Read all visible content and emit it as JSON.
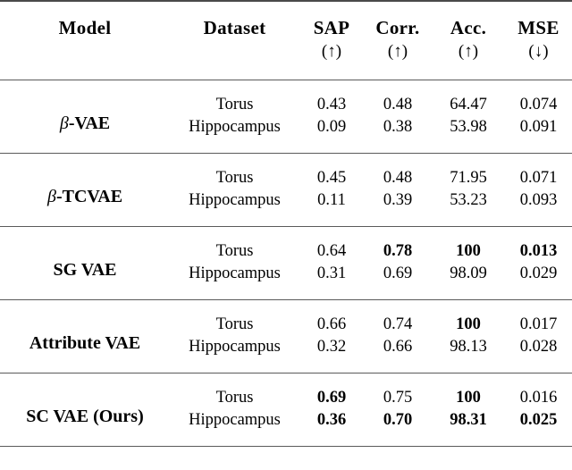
{
  "table": {
    "columns": [
      {
        "key": "model",
        "label": "Model",
        "arrow": ""
      },
      {
        "key": "dataset",
        "label": "Dataset",
        "arrow": ""
      },
      {
        "key": "sap",
        "label": "SAP",
        "arrow": "(↑)"
      },
      {
        "key": "corr",
        "label": "Corr.",
        "arrow": "(↑)"
      },
      {
        "key": "acc",
        "label": "Acc.",
        "arrow": "(↑)"
      },
      {
        "key": "mse",
        "label": "MSE",
        "arrow": "(↓)"
      }
    ],
    "groups": [
      {
        "model_prefix": "β",
        "model_rest": "-VAE",
        "rows": [
          {
            "dataset": "Torus",
            "dataset_bold": false,
            "sap": "0.43",
            "sap_bold": false,
            "corr": "0.48",
            "corr_bold": false,
            "acc": "64.47",
            "acc_bold": false,
            "mse": "0.074",
            "mse_bold": false
          },
          {
            "dataset": "Hippocampus",
            "dataset_bold": false,
            "sap": "0.09",
            "sap_bold": false,
            "corr": "0.38",
            "corr_bold": false,
            "acc": "53.98",
            "acc_bold": false,
            "mse": "0.091",
            "mse_bold": false
          }
        ]
      },
      {
        "model_prefix": "β",
        "model_rest": "-TCVAE",
        "rows": [
          {
            "dataset": "Torus",
            "dataset_bold": false,
            "sap": "0.45",
            "sap_bold": false,
            "corr": "0.48",
            "corr_bold": false,
            "acc": "71.95",
            "acc_bold": false,
            "mse": "0.071",
            "mse_bold": false
          },
          {
            "dataset": "Hippocampus",
            "dataset_bold": false,
            "sap": "0.11",
            "sap_bold": false,
            "corr": "0.39",
            "corr_bold": false,
            "acc": "53.23",
            "acc_bold": false,
            "mse": "0.093",
            "mse_bold": false
          }
        ]
      },
      {
        "model_prefix": "",
        "model_rest": "SG VAE",
        "rows": [
          {
            "dataset": "Torus",
            "dataset_bold": false,
            "sap": "0.64",
            "sap_bold": false,
            "corr": "0.78",
            "corr_bold": true,
            "acc": "100",
            "acc_bold": true,
            "mse": "0.013",
            "mse_bold": true
          },
          {
            "dataset": "Hippocampus",
            "dataset_bold": false,
            "sap": "0.31",
            "sap_bold": false,
            "corr": "0.69",
            "corr_bold": false,
            "acc": "98.09",
            "acc_bold": false,
            "mse": "0.029",
            "mse_bold": false
          }
        ]
      },
      {
        "model_prefix": "",
        "model_rest": "Attribute VAE",
        "rows": [
          {
            "dataset": "Torus",
            "dataset_bold": false,
            "sap": "0.66",
            "sap_bold": false,
            "corr": "0.74",
            "corr_bold": false,
            "acc": "100",
            "acc_bold": true,
            "mse": "0.017",
            "mse_bold": false
          },
          {
            "dataset": "Hippocampus",
            "dataset_bold": false,
            "sap": "0.32",
            "sap_bold": false,
            "corr": "0.66",
            "corr_bold": false,
            "acc": "98.13",
            "acc_bold": false,
            "mse": "0.028",
            "mse_bold": false
          }
        ]
      },
      {
        "model_prefix": "",
        "model_rest": "SC VAE (Ours)",
        "rows": [
          {
            "dataset": "Torus",
            "dataset_bold": false,
            "sap": "0.69",
            "sap_bold": true,
            "corr": "0.75",
            "corr_bold": false,
            "acc": "100",
            "acc_bold": true,
            "mse": "0.016",
            "mse_bold": false
          },
          {
            "dataset": "Hippocampus",
            "dataset_bold": false,
            "sap": "0.36",
            "sap_bold": true,
            "corr": "0.70",
            "corr_bold": true,
            "acc": "98.31",
            "acc_bold": true,
            "mse": "0.025",
            "mse_bold": true
          }
        ]
      }
    ]
  }
}
